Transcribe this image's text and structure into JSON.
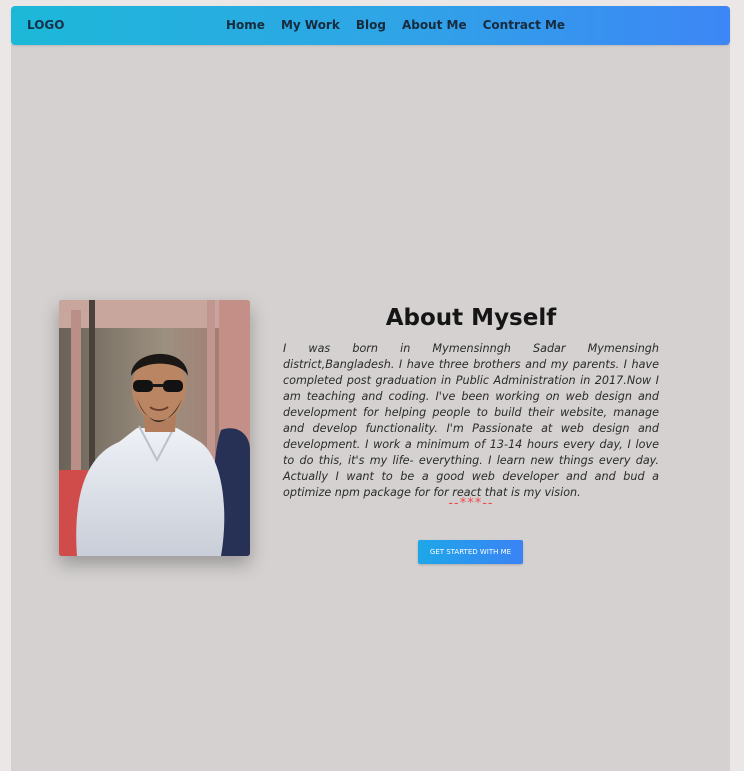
{
  "navbar": {
    "logo": "LOGO",
    "links": [
      {
        "label": "Home"
      },
      {
        "label": "My Work"
      },
      {
        "label": "Blog"
      },
      {
        "label": "About Me"
      },
      {
        "label": "Contract Me"
      }
    ]
  },
  "about": {
    "title": "About Myself",
    "bio": "I was born in Mymensinngh Sadar Mymensingh district,Bangladesh. I have three brothers and my parents. I have completed post graduation in Public Administration in 2017.Now I am teaching and coding. I've been working on web design and development for helping people to build their website, manage and develop functionality. I'm Passionate at web design and development. I work a minimum of 13-14 hours every day, I love to do this, it's my life- everything. I learn new things every day. Actually I want to be a good web developer and and bud a optimize npm package for for react that is my vision.",
    "divider": "--***--",
    "cta_label": "GET STARTED WITH ME"
  },
  "colors": {
    "navbar_start": "#1cb8d8",
    "navbar_end": "#3d86f5",
    "panel_bg": "#d4d1d0",
    "divider": "#ef4b50",
    "button_start": "#1da7e8",
    "button_end": "#3b82f5"
  }
}
